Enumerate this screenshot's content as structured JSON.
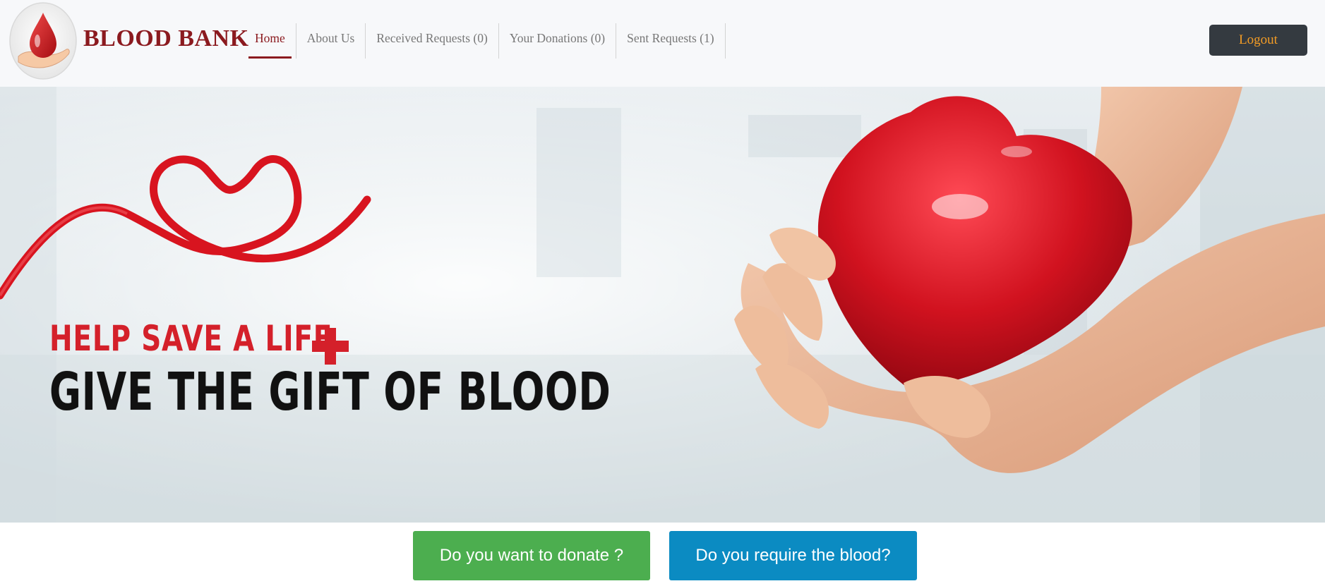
{
  "brand": {
    "name": "BLOOD BANK",
    "logo_icon": "blood-drop-hand-icon"
  },
  "nav": {
    "items": [
      {
        "label": "Home",
        "active": true
      },
      {
        "label": "About Us",
        "active": false
      },
      {
        "label": "Received Requests (0)",
        "active": false
      },
      {
        "label": "Your Donations (0)",
        "active": false
      },
      {
        "label": "Sent Requests (1)",
        "active": false
      }
    ],
    "logout_label": "Logout"
  },
  "hero": {
    "line1": "HELP SAVE A LIFE",
    "line2": "GIVE THE GIFT OF BLOOD",
    "icons": [
      "red-ribbon-heart-icon",
      "red-cross-icon",
      "hands-holding-heart-icon"
    ]
  },
  "actions": {
    "donate_label": "Do you want to donate ?",
    "require_label": "Do you require the blood?"
  },
  "colors": {
    "brand": "#8b1a1f",
    "logout_bg": "#343a40",
    "logout_text": "#f39c25",
    "donate": "#4cae4f",
    "require": "#0b8bc2",
    "accent_red": "#d4202a"
  }
}
